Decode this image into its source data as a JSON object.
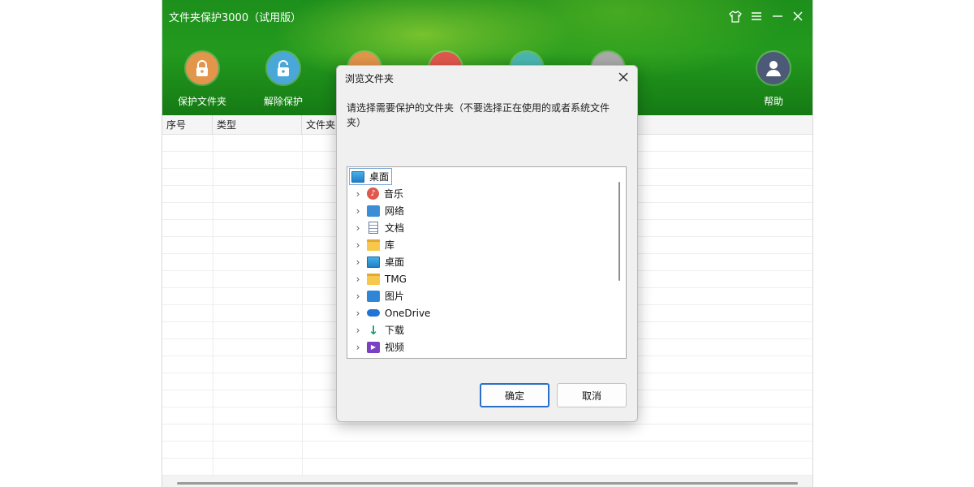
{
  "app": {
    "title": "文件夹保护3000（试用版）",
    "toolbar": [
      {
        "label": "保护文件夹",
        "icon": "lock-closed-icon",
        "color": "#e3954a"
      },
      {
        "label": "解除保护",
        "icon": "lock-open-icon",
        "color": "#4aa8d8"
      },
      {
        "label": "",
        "icon": "folder-icon",
        "color": "#e3954a"
      },
      {
        "label": "",
        "icon": "pie-icon",
        "color": "#e0574c"
      },
      {
        "label": "",
        "icon": "gear-icon",
        "color": "#4ab7b0"
      },
      {
        "label": "",
        "icon": "check-icon",
        "color": "#aaaaaa"
      },
      {
        "label": "帮助",
        "icon": "user-icon",
        "color": "#4c5a78"
      }
    ],
    "window_controls": [
      "shirt-icon",
      "menu-icon",
      "minimize-icon",
      "close-icon"
    ],
    "table": {
      "columns": [
        "序号",
        "类型",
        "文件夹"
      ]
    }
  },
  "dialog": {
    "title": "浏览文件夹",
    "message": "请选择需要保护的文件夹（不要选择正在使用的或者系统文件夹）",
    "tree": {
      "root": "桌面",
      "items": [
        {
          "label": "音乐",
          "icon": "music-icon"
        },
        {
          "label": "网络",
          "icon": "network-icon"
        },
        {
          "label": "文档",
          "icon": "document-icon"
        },
        {
          "label": "库",
          "icon": "folder-icon"
        },
        {
          "label": "桌面",
          "icon": "desktop-icon"
        },
        {
          "label": "TMG",
          "icon": "folder-icon"
        },
        {
          "label": "图片",
          "icon": "pictures-icon"
        },
        {
          "label": "OneDrive",
          "icon": "cloud-icon"
        },
        {
          "label": "下载",
          "icon": "download-icon"
        },
        {
          "label": "视频",
          "icon": "video-icon"
        }
      ]
    },
    "ok_label": "确定",
    "cancel_label": "取消"
  }
}
